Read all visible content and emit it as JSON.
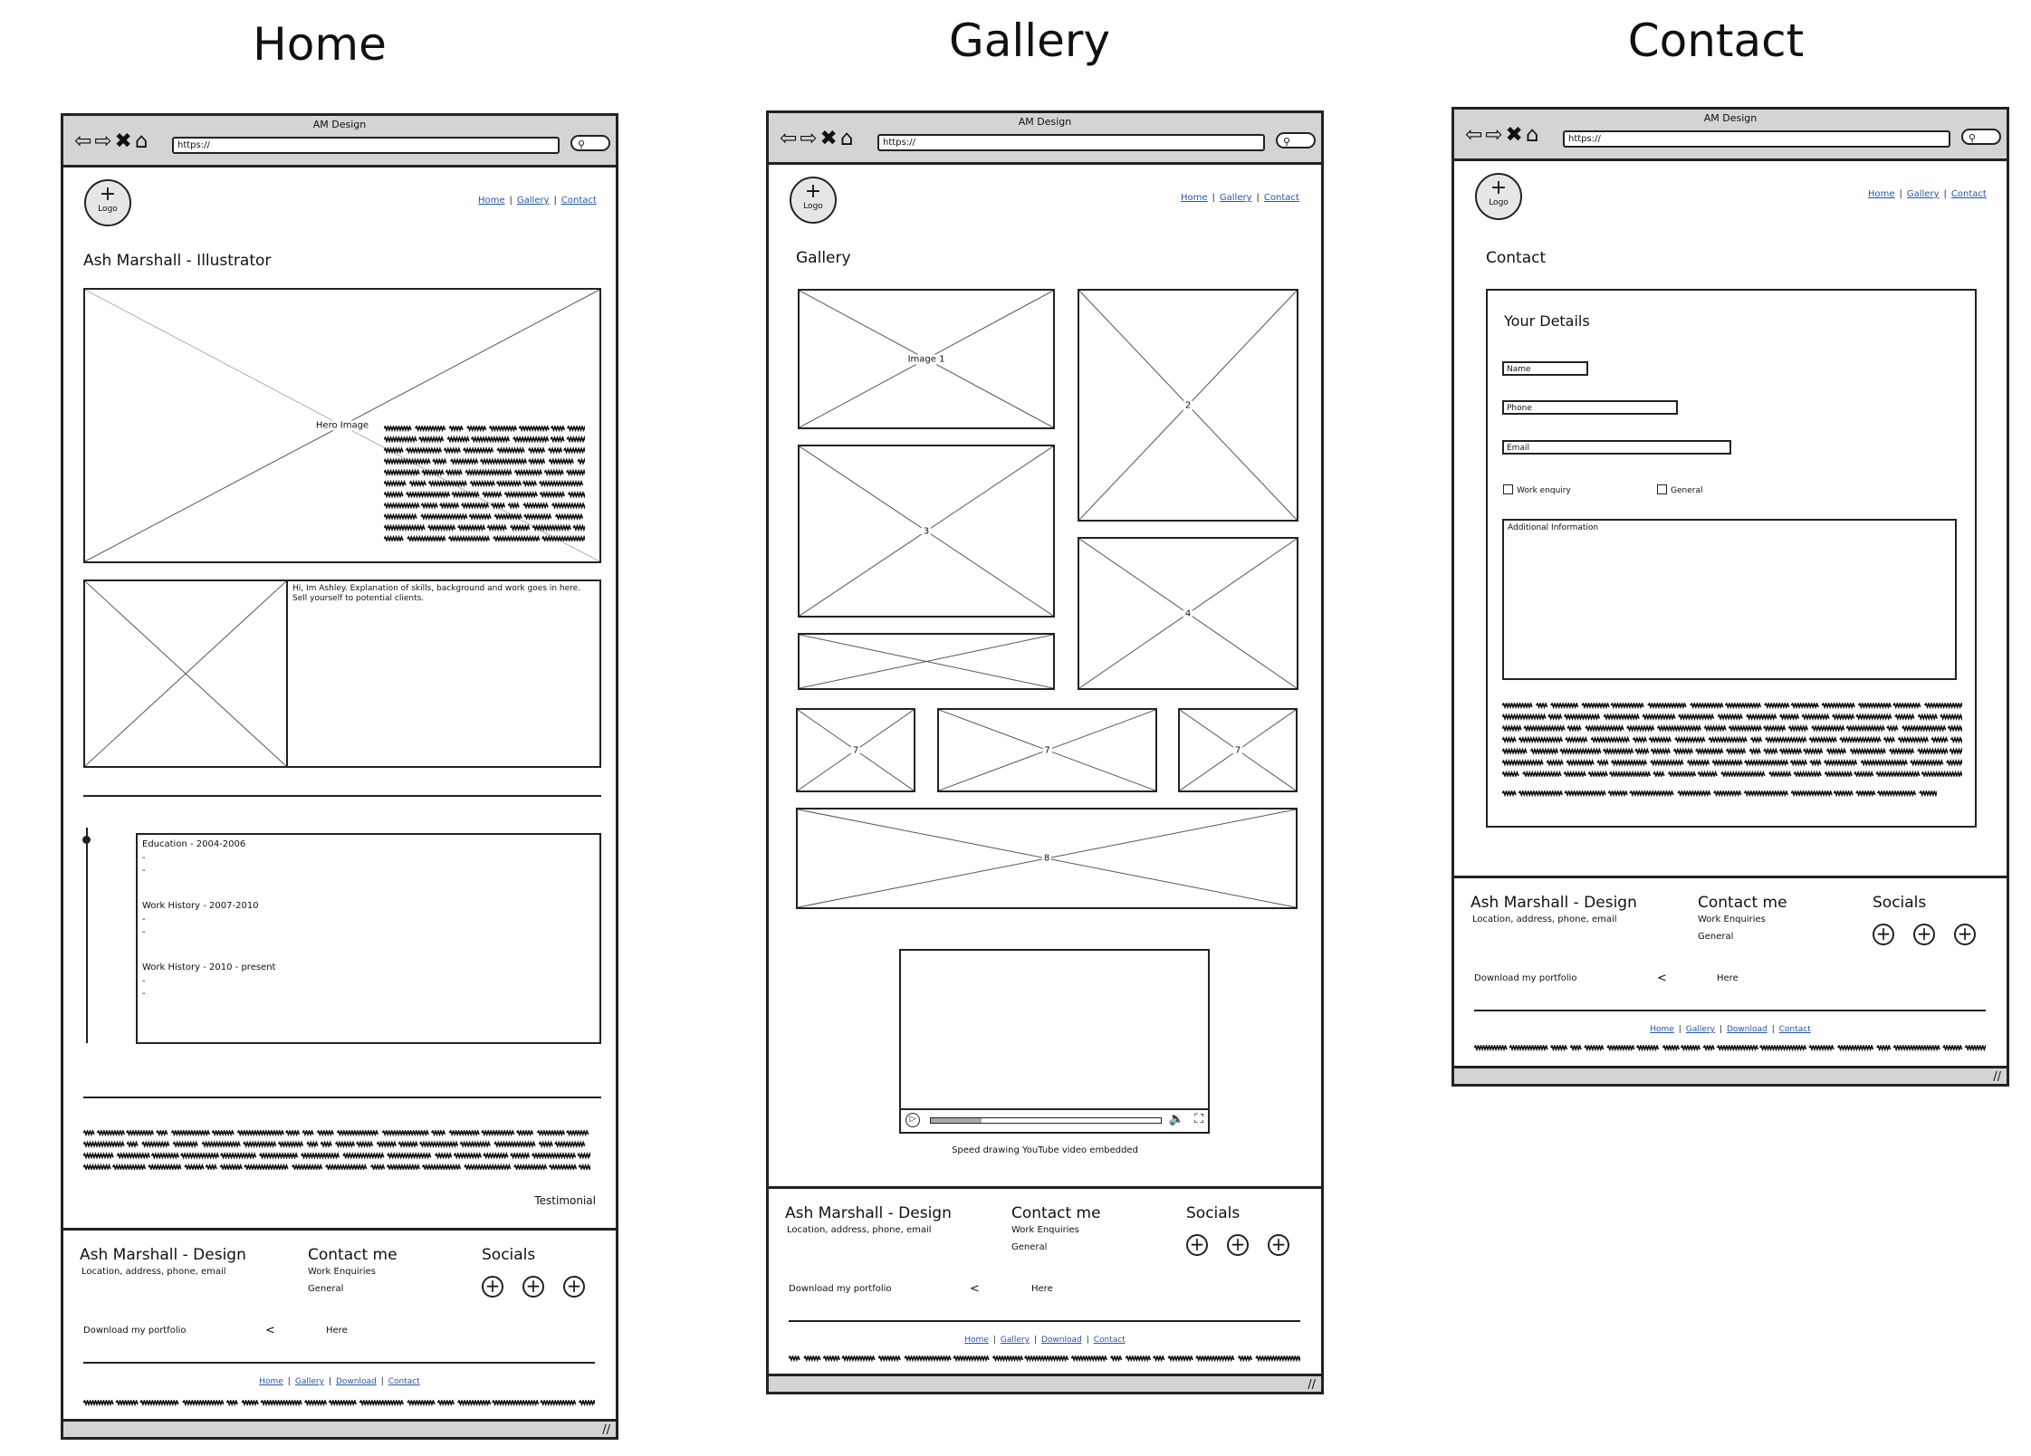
{
  "page_headings": {
    "home": "Home",
    "gallery": "Gallery",
    "contact": "Contact"
  },
  "browser": {
    "window_title": "AM Design",
    "url": "https://",
    "nav_glyphs": "⇦⇨✖⌂",
    "search_glyph": "⚲",
    "resize_glyph": "//"
  },
  "logo": {
    "plus": "+",
    "label": "Logo"
  },
  "nav": {
    "home": "Home",
    "gallery": "Gallery",
    "contact": "Contact",
    "download": "Download"
  },
  "home": {
    "title": "Ash Marshall - Illustrator",
    "hero_label": "Hero Image",
    "about_text": "Hi, Im Ashley. Explanation of skills, background and work goes in here. Sell yourself to potential clients.",
    "timeline": {
      "education": "Education - 2004-2006",
      "work1": "Work History - 2007-2010",
      "work2": "Work History - 2010 - present",
      "dash": "-"
    },
    "testimonial": "Testimonial"
  },
  "gallery": {
    "title": "Gallery",
    "image1": "Image 1",
    "image2": "2",
    "image3": "3",
    "image4": "4",
    "image7a": "7",
    "image7b": "7",
    "image7c": "7",
    "image8": "8",
    "video_caption": "Speed drawing YouTube video embedded"
  },
  "contact": {
    "title": "Contact",
    "form_title": "Your Details",
    "name_placeholder": "Name",
    "phone_placeholder": "Phone",
    "email_placeholder": "Email",
    "check_work": "Work enquiry",
    "check_general": "General",
    "additional": "Additional Information"
  },
  "footer": {
    "brand": "Ash Marshall - Design",
    "brand_sub": "Location, address, phone, email",
    "contact_title": "Contact me",
    "contact_work": "Work Enquiries",
    "contact_general": "General",
    "socials_title": "Socials",
    "social_glyph": "+",
    "download_label": "Download my portfolio",
    "download_arrow": "<",
    "download_here": "Here"
  }
}
